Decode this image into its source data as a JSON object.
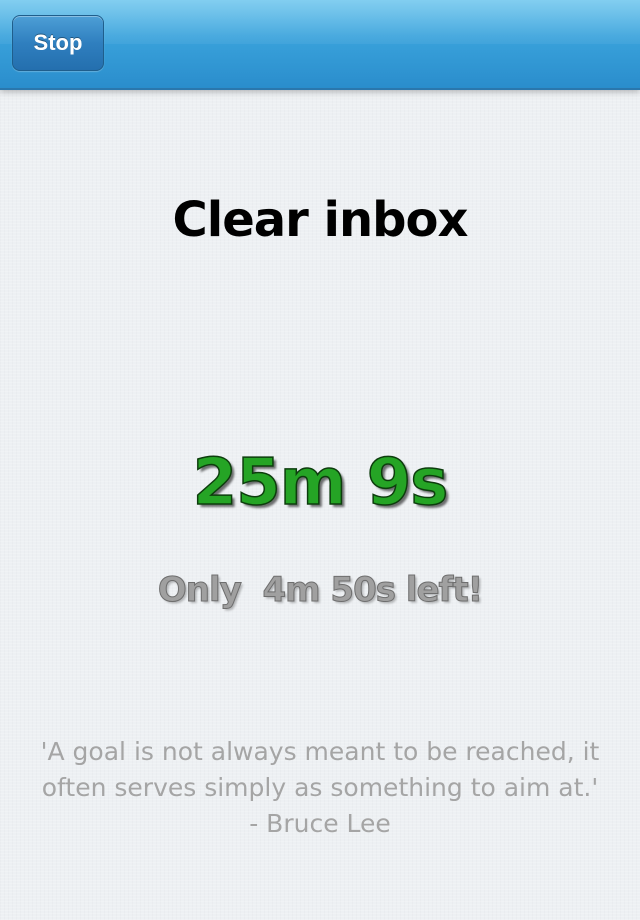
{
  "toolbar": {
    "stop_label": "Stop"
  },
  "timer": {
    "task_title": "Clear inbox",
    "elapsed": "25m 9s",
    "remaining": "Only  4m 50s left!"
  },
  "quote": {
    "text": "'A goal is not always meant to be reached, it often serves simply as something to aim at.' - Bruce Lee"
  },
  "colors": {
    "nav_bar": "#3aa3dc",
    "elapsed_text": "#25a425",
    "muted_text": "#a0a0a0",
    "background": "#edf0f3"
  }
}
